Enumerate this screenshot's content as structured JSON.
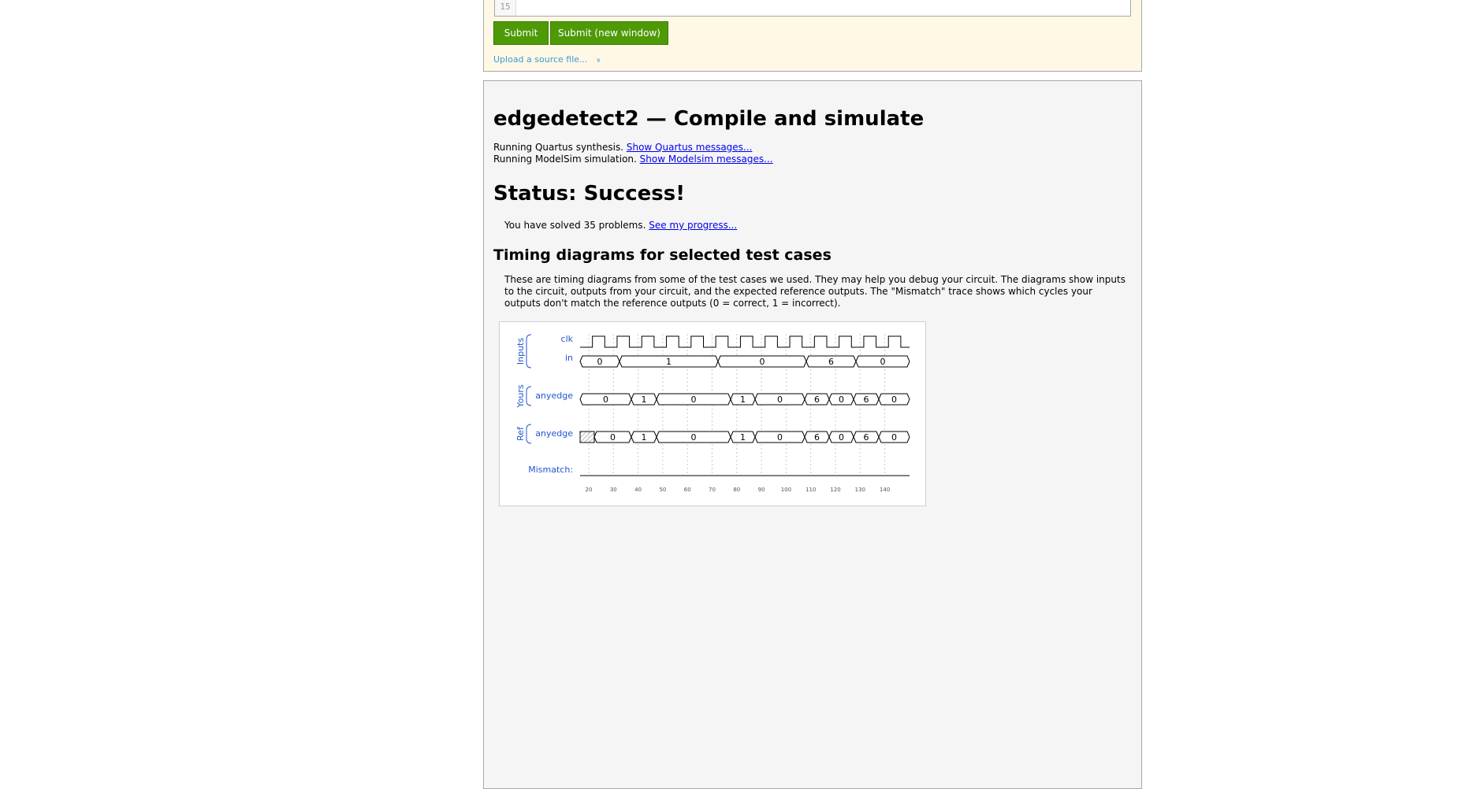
{
  "editor": {
    "line_number": "15"
  },
  "toolbar": {
    "submit_label": "Submit",
    "submit_new_window_label": "Submit (new window)",
    "upload_label": "Upload a source file...",
    "upload_chevron": "»"
  },
  "result": {
    "title": "edgedetect2 — Compile and simulate",
    "quartus_text": "Running Quartus synthesis.",
    "quartus_link": "Show Quartus messages...",
    "modelsim_text": "Running ModelSim simulation.",
    "modelsim_link": "Show Modelsim messages...",
    "status": "Status: Success!",
    "solved_text": "You have solved 35 problems.",
    "progress_link": "See my progress...",
    "timing_heading": "Timing diagrams for selected test cases",
    "timing_description": "These are timing diagrams from some of the test cases we used. They may help you debug your circuit. The diagrams show inputs to the circuit, outputs from your circuit, and the expected reference outputs. The \"Mismatch\" trace shows which cycles your outputs don't match the reference outputs (0 = correct, 1 = incorrect)."
  },
  "timing_diagram": {
    "groups": [
      "Inputs",
      "Yours",
      "Ref"
    ],
    "signals": [
      "clk",
      "in",
      "anyedge",
      "anyedge",
      "Mismatch:"
    ],
    "in_values": [
      "0",
      "1",
      "0",
      "6",
      "0"
    ],
    "yours_values": [
      "0",
      "1",
      "0",
      "1",
      "0",
      "6",
      "0",
      "6",
      "0"
    ],
    "ref_values": [
      "0",
      "1",
      "0",
      "1",
      "0",
      "6",
      "0",
      "6",
      "0"
    ],
    "time_ticks": [
      "20",
      "30",
      "40",
      "50",
      "60",
      "70",
      "80",
      "90",
      "100",
      "110",
      "120",
      "130",
      "140"
    ],
    "colors": {
      "signal_label": "#2255cc",
      "grid": "#c8c8c8",
      "wave": "#000000"
    }
  }
}
